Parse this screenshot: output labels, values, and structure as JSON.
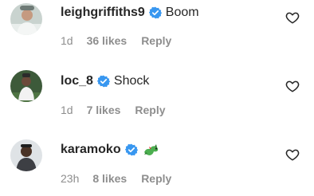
{
  "comments": [
    {
      "username": "leighgriffiths9",
      "text": "Boom",
      "time": "1d",
      "likes": "36 likes",
      "reply": "Reply",
      "verified": true,
      "avatar_icon": "user-avatar-photo",
      "like_icon": "heart-outline-icon"
    },
    {
      "username": "loc_8",
      "text": "Shock",
      "time": "1d",
      "likes": "7 likes",
      "reply": "Reply",
      "verified": true,
      "avatar_icon": "user-avatar-photo",
      "like_icon": "heart-outline-icon"
    },
    {
      "username": "karamoko",
      "text": "",
      "emoji": "dragon-emoji",
      "time": "23h",
      "likes": "8 likes",
      "reply": "Reply",
      "verified": true,
      "avatar_icon": "user-avatar-photo",
      "like_icon": "heart-outline-icon"
    }
  ],
  "colors": {
    "text": "#262626",
    "meta": "#8e8e8e",
    "verified": "#3897f0"
  }
}
